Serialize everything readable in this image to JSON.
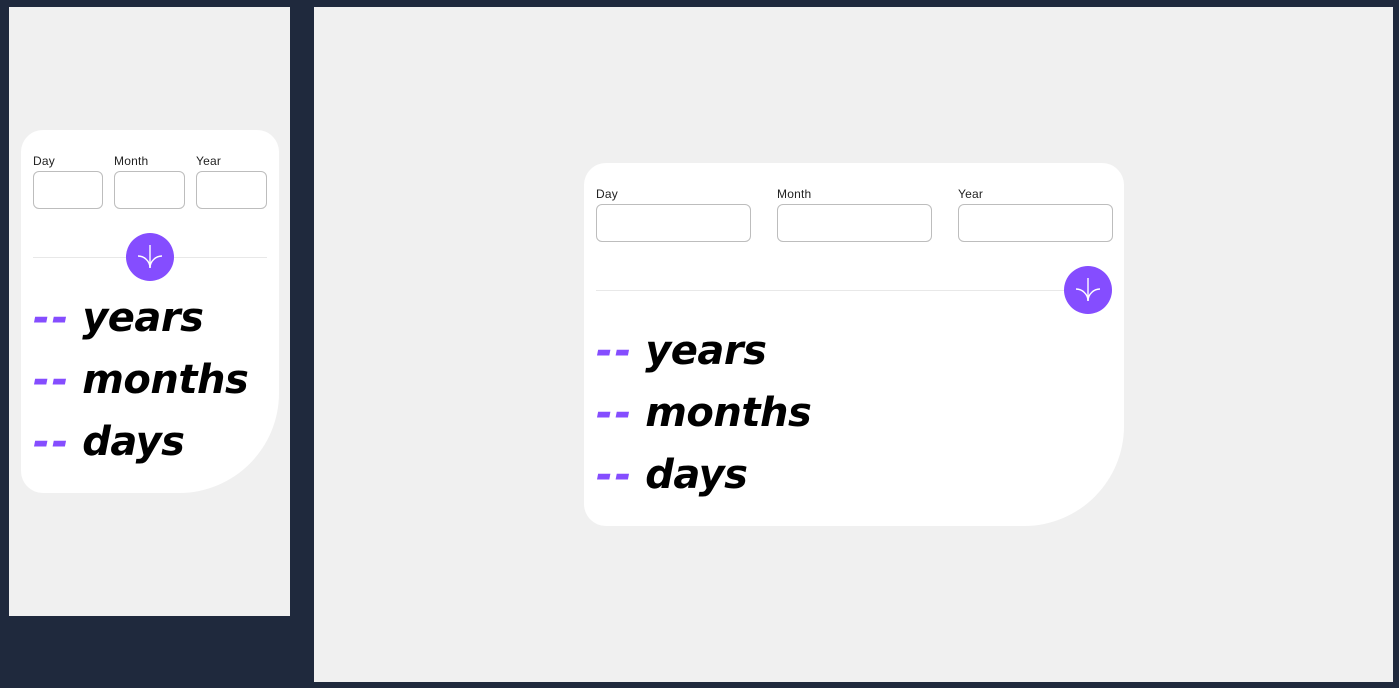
{
  "form": {
    "day_label": "Day",
    "month_label": "Month",
    "year_label": "Year",
    "day_value": "",
    "month_value": "",
    "year_value": ""
  },
  "submit": {
    "icon": "arrow-down-icon",
    "color": "#854dff"
  },
  "results": {
    "years_value": "--",
    "years_label": "years",
    "months_value": "--",
    "months_label": "months",
    "days_value": "--",
    "days_label": "days"
  },
  "colors": {
    "accent": "#854dff",
    "page_background": "#f0f0f0",
    "card_background": "#ffffff",
    "frame_background": "#1f293d"
  }
}
